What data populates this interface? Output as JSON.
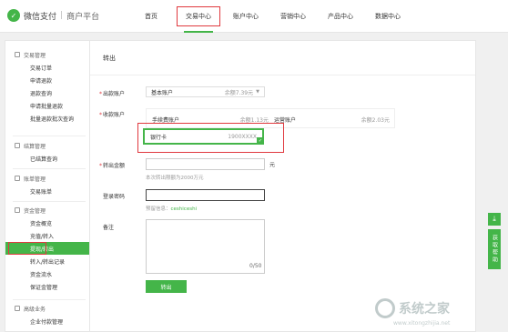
{
  "header": {
    "logo_text": "微信支付",
    "separator": "|",
    "platform": "商户平台",
    "nav": [
      "首页",
      "交易中心",
      "账户中心",
      "营销中心",
      "产品中心",
      "数据中心"
    ],
    "active_nav": "交易中心"
  },
  "sidebar": {
    "groups": [
      {
        "title": "交易管理",
        "items": [
          "交易订单",
          "申请退款",
          "退款查询",
          "申请批量退款",
          "批量退款批次查询"
        ]
      },
      {
        "title": "结算管理",
        "items": [
          "已结算查询"
        ]
      },
      {
        "title": "账单管理",
        "items": [
          "交易账单"
        ]
      },
      {
        "title": "资金管理",
        "items": [
          "资金概览",
          "充值/转入",
          "提现/转出",
          "转入/转出记录",
          "资金流水",
          "保证金管理"
        ]
      },
      {
        "title": "高级业务",
        "items": [
          "企业付款管理"
        ]
      }
    ],
    "active_item": "提现/转出"
  },
  "main": {
    "title": "转出",
    "out_account_label": "出款账户",
    "out_account_value": "基本账户",
    "out_account_balance": "余额7.39元",
    "in_account_label": "收款账户",
    "accounts": [
      {
        "name": "手续费账户",
        "balance": "余额1.13元"
      },
      {
        "name": "运营账户",
        "balance": "余额2.03元"
      }
    ],
    "bank_label": "银行卡",
    "bank_account": "1900XXXX",
    "amount_label": "转出金额",
    "amount_unit": "元",
    "amount_hint": "本次转出限额为2000万元",
    "password_label": "登录密码",
    "password_hint_prefix": "预留信息：",
    "password_hint_value": "ceshiceshi",
    "remark_label": "备注",
    "remark_count": "0/50",
    "submit_label": "转出"
  },
  "side_tools": {
    "help_label": "获取帮助"
  },
  "watermark": {
    "text": "系统之家",
    "url": "www.xitongzhijia.net"
  },
  "colors": {
    "accent": "#44b549",
    "highlight_red": "#e0393e"
  }
}
